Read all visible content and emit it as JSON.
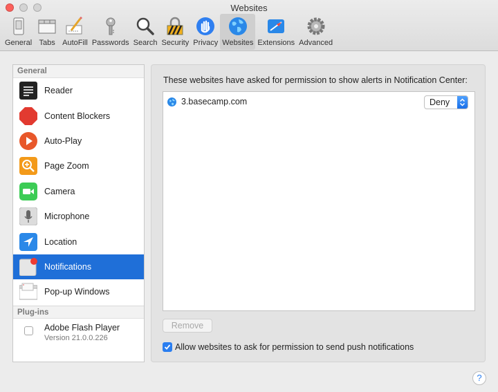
{
  "window": {
    "title": "Websites"
  },
  "toolbar": {
    "items": [
      {
        "label": "General",
        "icon": "switch-icon"
      },
      {
        "label": "Tabs",
        "icon": "tabs-icon"
      },
      {
        "label": "AutoFill",
        "icon": "pencil-form-icon"
      },
      {
        "label": "Passwords",
        "icon": "key-icon"
      },
      {
        "label": "Search",
        "icon": "magnifier-icon"
      },
      {
        "label": "Security",
        "icon": "padlock-icon"
      },
      {
        "label": "Privacy",
        "icon": "hand-icon"
      },
      {
        "label": "Websites",
        "icon": "globe-icon",
        "selected": true
      },
      {
        "label": "Extensions",
        "icon": "puzzle-icon"
      },
      {
        "label": "Advanced",
        "icon": "gear-icon"
      }
    ]
  },
  "sidebar": {
    "general_header": "General",
    "items": [
      {
        "label": "Reader",
        "icon": "reader-icon"
      },
      {
        "label": "Content Blockers",
        "icon": "stop-sign-icon"
      },
      {
        "label": "Auto-Play",
        "icon": "play-icon"
      },
      {
        "label": "Page Zoom",
        "icon": "zoom-icon"
      },
      {
        "label": "Camera",
        "icon": "camera-icon"
      },
      {
        "label": "Microphone",
        "icon": "microphone-icon"
      },
      {
        "label": "Location",
        "icon": "location-arrow-icon"
      },
      {
        "label": "Notifications",
        "icon": "notification-badge-icon",
        "selected": true
      },
      {
        "label": "Pop-up Windows",
        "icon": "popup-window-icon"
      }
    ],
    "plugins_header": "Plug-ins",
    "plugins": [
      {
        "name": "Adobe Flash Player",
        "version": "Version 21.0.0.226",
        "enabled": false
      }
    ]
  },
  "main": {
    "description": "These websites have asked for permission to show alerts in Notification Center:",
    "sites": [
      {
        "domain": "3.basecamp.com",
        "permission": "Deny"
      }
    ],
    "remove_label": "Remove",
    "allow_label": "Allow websites to ask for permission to send push notifications",
    "allow_checked": true
  },
  "help": {
    "label": "?"
  },
  "colors": {
    "accent": "#1f6fd8",
    "close": "#fc605b",
    "checkbox": "#2a7ef0"
  }
}
